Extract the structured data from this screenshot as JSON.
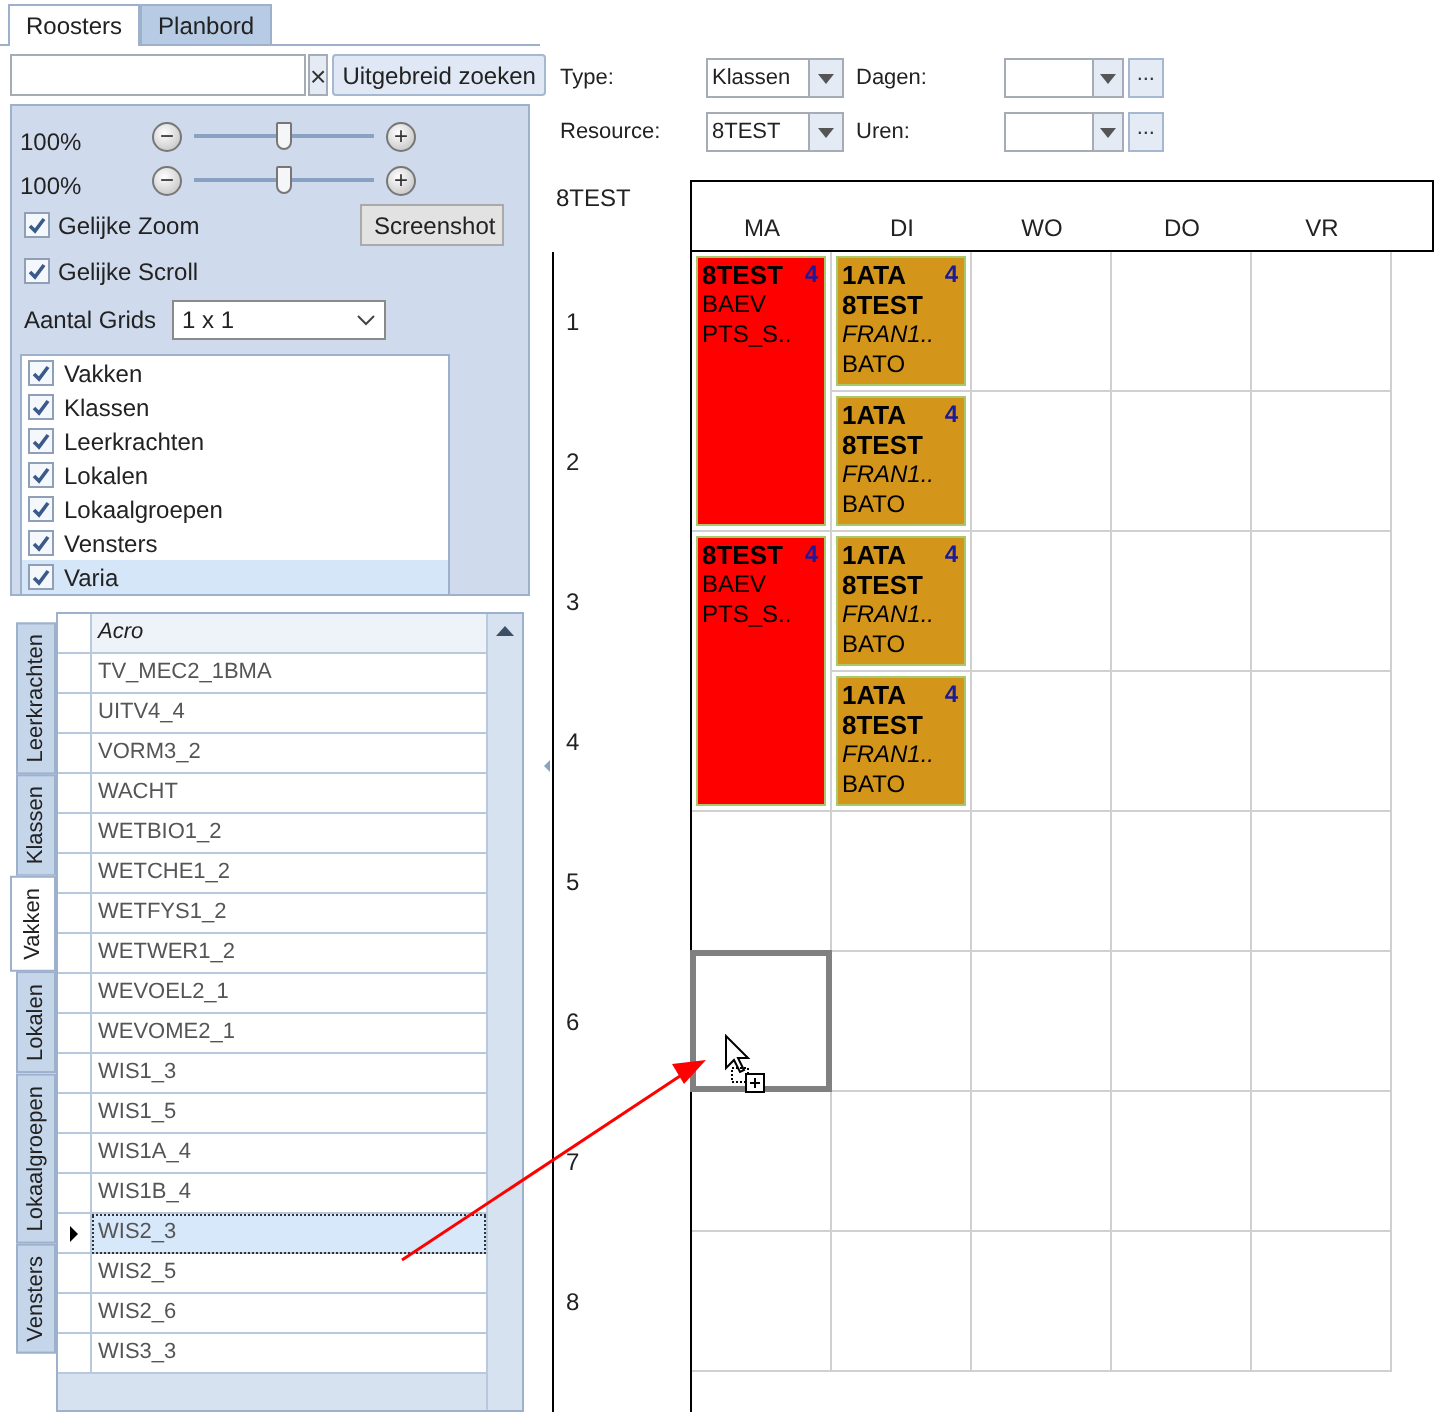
{
  "tabs": [
    {
      "label": "Roosters",
      "selected": true
    },
    {
      "label": "Planbord",
      "selected": false
    }
  ],
  "search": {
    "clear": "×",
    "advanced": "Uitgebreid zoeken"
  },
  "zoom": [
    {
      "reading": "100%",
      "minus": "−",
      "plus": "+",
      "level": 0.5
    },
    {
      "reading": "100%",
      "minus": "−",
      "plus": "+",
      "level": 0.5
    }
  ],
  "options": [
    {
      "label": "Gelijke Zoom",
      "checked": true
    },
    {
      "label": "Gelijke Scroll",
      "checked": true
    }
  ],
  "screenshot_button": "Screenshot",
  "grids": {
    "label": "Aantal Grids",
    "value": "1 x 1"
  },
  "layers": [
    {
      "label": "Vakken",
      "checked": true,
      "selected": false
    },
    {
      "label": "Klassen",
      "checked": true,
      "selected": false
    },
    {
      "label": "Leerkrachten",
      "checked": true,
      "selected": false
    },
    {
      "label": "Lokalen",
      "checked": true,
      "selected": false
    },
    {
      "label": "Lokaalgroepen",
      "checked": true,
      "selected": false
    },
    {
      "label": "Vensters",
      "checked": true,
      "selected": false
    },
    {
      "label": "Varia",
      "checked": true,
      "selected": true
    }
  ],
  "side_tabs": [
    {
      "label": "Leerkrachten",
      "selected": false
    },
    {
      "label": "Klassen",
      "selected": false
    },
    {
      "label": "Vakken",
      "selected": true
    },
    {
      "label": "Lokalen",
      "selected": false
    },
    {
      "label": "Lokaalgroepen",
      "selected": false
    },
    {
      "label": "Vensters",
      "selected": false
    }
  ],
  "table": {
    "column": "Acro",
    "rows": [
      {
        "acro": "TV_MEC2_1BMA",
        "selected": false
      },
      {
        "acro": "UITV4_4",
        "selected": false
      },
      {
        "acro": "VORM3_2",
        "selected": false
      },
      {
        "acro": "WACHT",
        "selected": false
      },
      {
        "acro": "WETBIO1_2",
        "selected": false
      },
      {
        "acro": "WETCHE1_2",
        "selected": false
      },
      {
        "acro": "WETFYS1_2",
        "selected": false
      },
      {
        "acro": "WETWER1_2",
        "selected": false
      },
      {
        "acro": "WEVOEL2_1",
        "selected": false
      },
      {
        "acro": "WEVOME2_1",
        "selected": false
      },
      {
        "acro": "WIS1_3",
        "selected": false
      },
      {
        "acro": "WIS1_5",
        "selected": false
      },
      {
        "acro": "WIS1A_4",
        "selected": false
      },
      {
        "acro": "WIS1B_4",
        "selected": false
      },
      {
        "acro": "WIS2_3",
        "selected": true
      },
      {
        "acro": "WIS2_5",
        "selected": false
      },
      {
        "acro": "WIS2_6",
        "selected": false
      },
      {
        "acro": "WIS3_3",
        "selected": false
      }
    ]
  },
  "filters": [
    {
      "label": "Type:",
      "value": "Klassen"
    },
    {
      "label": "Dagen:",
      "more": "..."
    },
    {
      "label": "Resource:",
      "value": "8TEST"
    },
    {
      "label": "Uren:",
      "more": "..."
    }
  ],
  "schedule": {
    "title": "8TEST",
    "hours": [
      "1",
      "2",
      "3",
      "4",
      "5",
      "6",
      "7",
      "8"
    ],
    "days": [
      {
        "label": "MA",
        "slots": [
          {
            "kind": "lesson",
            "color": "#ff0000",
            "count": "4",
            "lines": [
              {
                "text": "8TEST",
                "kind": "bold"
              },
              {
                "text": "BAEV",
                "kind": "plain"
              },
              {
                "text": "PTS_S..",
                "kind": "plain"
              }
            ]
          },
          {
            "kind": "continued"
          },
          {
            "kind": "lesson",
            "color": "#ff0000",
            "count": "4",
            "lines": [
              {
                "text": "8TEST",
                "kind": "bold"
              },
              {
                "text": "BAEV",
                "kind": "plain"
              },
              {
                "text": "PTS_S..",
                "kind": "plain"
              }
            ]
          },
          {
            "kind": "continued"
          },
          {
            "kind": "empty"
          },
          {
            "kind": "drop-target"
          },
          {
            "kind": "empty"
          },
          {
            "kind": "empty"
          }
        ]
      },
      {
        "label": "DI",
        "slots": [
          {
            "kind": "lesson",
            "color": "#d4961a",
            "count": "4",
            "lines": [
              {
                "text": "1ATA",
                "kind": "bold"
              },
              {
                "text": "8TEST",
                "kind": "bold"
              },
              {
                "text": "FRAN1..",
                "kind": "italic"
              },
              {
                "text": "BATO",
                "kind": "plain"
              }
            ]
          },
          {
            "kind": "lesson",
            "color": "#d4961a",
            "count": "4",
            "lines": [
              {
                "text": "1ATA",
                "kind": "bold"
              },
              {
                "text": "8TEST",
                "kind": "bold"
              },
              {
                "text": "FRAN1..",
                "kind": "italic"
              },
              {
                "text": "BATO",
                "kind": "plain"
              }
            ]
          },
          {
            "kind": "lesson",
            "color": "#d4961a",
            "count": "4",
            "lines": [
              {
                "text": "1ATA",
                "kind": "bold"
              },
              {
                "text": "8TEST",
                "kind": "bold"
              },
              {
                "text": "FRAN1..",
                "kind": "italic"
              },
              {
                "text": "BATO",
                "kind": "plain"
              }
            ]
          },
          {
            "kind": "lesson",
            "color": "#d4961a",
            "count": "4",
            "lines": [
              {
                "text": "1ATA",
                "kind": "bold"
              },
              {
                "text": "8TEST",
                "kind": "bold"
              },
              {
                "text": "FRAN1..",
                "kind": "italic"
              },
              {
                "text": "BATO",
                "kind": "plain"
              }
            ]
          },
          {
            "kind": "empty"
          },
          {
            "kind": "empty"
          },
          {
            "kind": "empty"
          },
          {
            "kind": "empty"
          }
        ]
      },
      {
        "label": "WO",
        "slots": [
          {
            "kind": "empty"
          },
          {
            "kind": "empty"
          },
          {
            "kind": "empty"
          },
          {
            "kind": "empty"
          },
          {
            "kind": "empty"
          },
          {
            "kind": "empty"
          },
          {
            "kind": "empty"
          },
          {
            "kind": "empty"
          }
        ]
      },
      {
        "label": "DO",
        "slots": [
          {
            "kind": "empty"
          },
          {
            "kind": "empty"
          },
          {
            "kind": "empty"
          },
          {
            "kind": "empty"
          },
          {
            "kind": "empty"
          },
          {
            "kind": "empty"
          },
          {
            "kind": "empty"
          },
          {
            "kind": "empty"
          }
        ]
      },
      {
        "label": "VR",
        "slots": [
          {
            "kind": "empty"
          },
          {
            "kind": "empty"
          },
          {
            "kind": "empty"
          },
          {
            "kind": "empty"
          },
          {
            "kind": "empty"
          },
          {
            "kind": "empty"
          },
          {
            "kind": "empty"
          },
          {
            "kind": "empty"
          }
        ]
      }
    ]
  }
}
